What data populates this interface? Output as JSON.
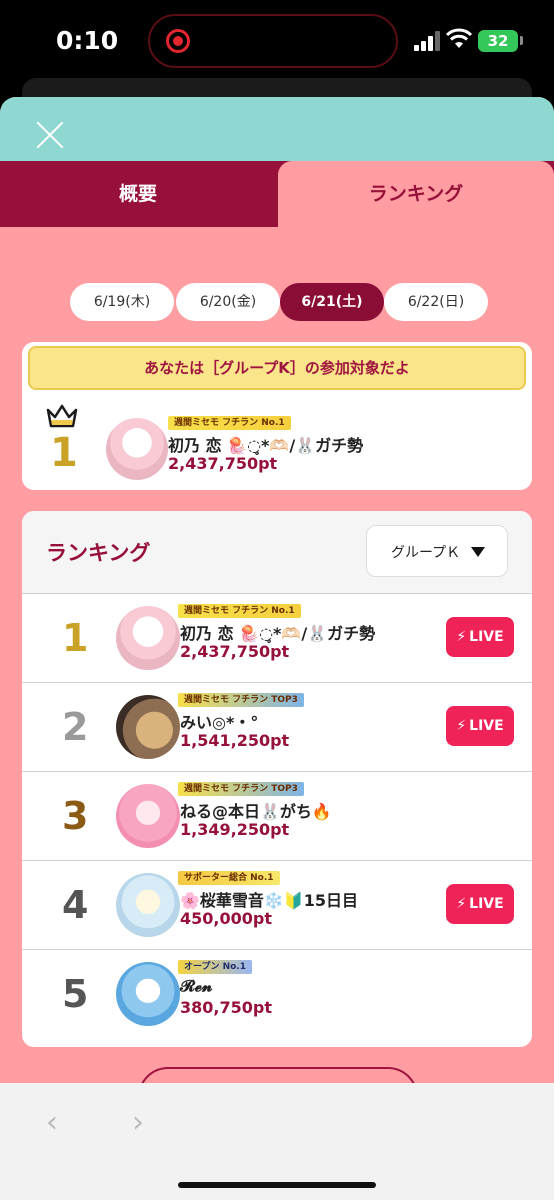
{
  "status": {
    "time": "0:10",
    "battery": "32"
  },
  "tabs": {
    "overview": "概要",
    "ranking": "ランキング"
  },
  "dates": [
    "6/19(木)",
    "6/20(金)",
    "6/21(土)",
    "6/22(日)"
  ],
  "active_date_index": 2,
  "my_rank": {
    "notice": "あなたは［グループK］の参加対象だよ",
    "rank": "1",
    "badge": "週間ミセモ フチラン No.1",
    "name": "初乃 恋 🪼◌̥*🫶🏻/🐰ガチ勢",
    "points": "2,437,750pt"
  },
  "ranking": {
    "title": "ランキング",
    "group_select": "グループＫ",
    "live_label": "LIVE",
    "rows": [
      {
        "rank": "1",
        "badge": "週間ミセモ フチラン No.1",
        "name": "初乃 恋 🪼◌̥*🫶🏻/🐰ガチ勢",
        "points": "2,437,750pt",
        "live": true
      },
      {
        "rank": "2",
        "badge": "週間ミセモ フチラン TOP3",
        "name": "みい◎*・°",
        "points": "1,541,250pt",
        "live": true
      },
      {
        "rank": "3",
        "badge": "週間ミセモ フチラン TOP3",
        "name": "ねる@本日🐰がち🔥",
        "points": "1,349,250pt",
        "live": false
      },
      {
        "rank": "4",
        "badge": "サポーター総合 No.1",
        "name": "🌸桜華雪音❄️🔰15日目",
        "points": "450,000pt",
        "live": true
      },
      {
        "rank": "5",
        "badge": "オープン No.1",
        "name": "𝓡𝓮𝓷",
        "points": "380,750pt",
        "live": false
      }
    ]
  },
  "colors": {
    "brand": "#97103a",
    "sheet_bg": "#ff9da3",
    "header_teal": "#8ed8d1",
    "live": "#f02359"
  }
}
